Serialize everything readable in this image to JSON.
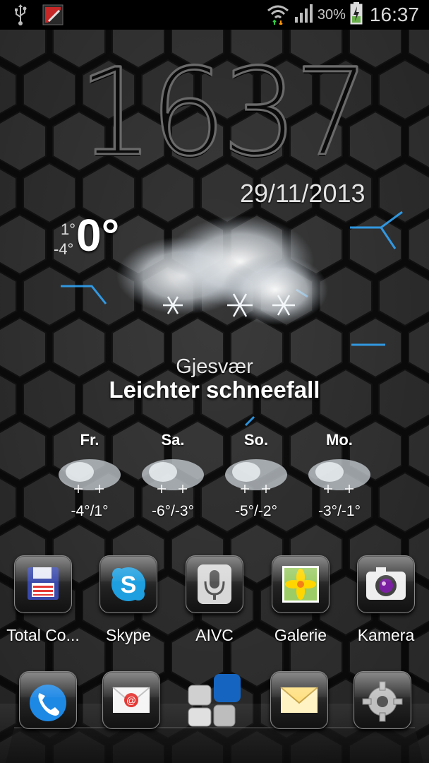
{
  "status_bar": {
    "battery_percent": "30%",
    "time": "16:37",
    "icons": [
      "usb-icon",
      "app-notification-icon",
      "wifi-icon",
      "signal-icon",
      "battery-charging-icon"
    ]
  },
  "clock": {
    "digits": "1637",
    "date": "29/11/2013"
  },
  "weather": {
    "high": "1°",
    "low": "-4°",
    "current": "0°",
    "icon": "snow-cloud-icon",
    "location": "Gjesvær",
    "condition": "Leichter schneefall",
    "forecast": [
      {
        "day": "Fr.",
        "temps": "-4°/1°",
        "icon": "snow-cloud-icon"
      },
      {
        "day": "Sa.",
        "temps": "-6°/-3°",
        "icon": "snow-cloud-icon"
      },
      {
        "day": "So.",
        "temps": "-5°/-2°",
        "icon": "snow-cloud-icon"
      },
      {
        "day": "Mo.",
        "temps": "-3°/-1°",
        "icon": "snow-cloud-icon"
      }
    ]
  },
  "apps": [
    {
      "label": "Total Co...",
      "icon": "floppy-disk-icon"
    },
    {
      "label": "Skype",
      "icon": "skype-icon"
    },
    {
      "label": "AIVC",
      "icon": "microphone-icon"
    },
    {
      "label": "Galerie",
      "icon": "flower-photo-icon"
    },
    {
      "label": "Kamera",
      "icon": "camera-icon"
    }
  ],
  "dock": [
    {
      "icon": "phone-icon"
    },
    {
      "icon": "email-icon"
    },
    {
      "icon": "app-drawer-icon"
    },
    {
      "icon": "messaging-icon"
    },
    {
      "icon": "settings-gear-icon"
    }
  ],
  "colors": {
    "accent_glow": "#33aaff",
    "background": "#1c1c1c",
    "hex_cell": "#3a3a3a",
    "hex_border": "#0d0d0d"
  }
}
